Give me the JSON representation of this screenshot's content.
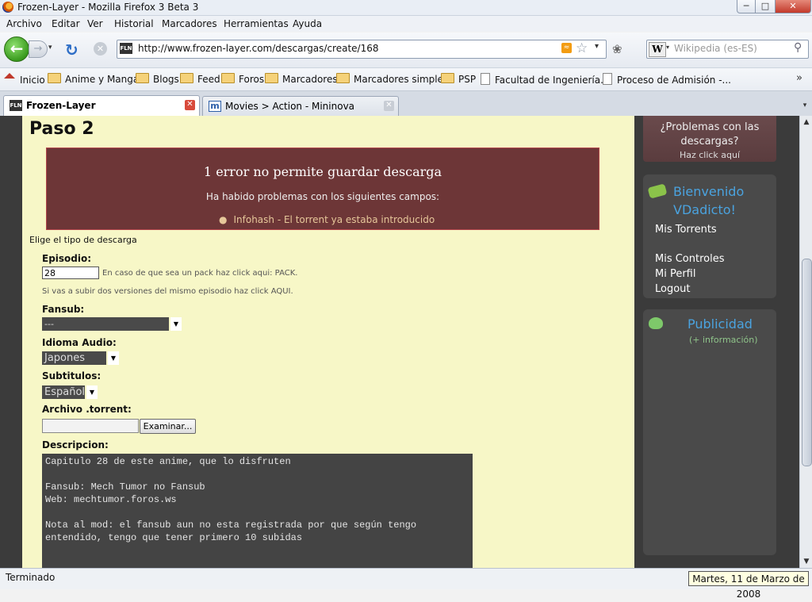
{
  "window": {
    "title": "Frozen-Layer - Mozilla Firefox 3 Beta 3",
    "min": "─",
    "max": "□",
    "close": "✕"
  },
  "menu": [
    "Archivo",
    "Editar",
    "Ver",
    "Historial",
    "Marcadores",
    "Herramientas",
    "Ayuda"
  ],
  "nav": {
    "back": "←",
    "forward": "→",
    "history": "▾",
    "reload": "↻",
    "stop": "✕",
    "url": "http://www.frozen-layer.com/descargas/create/168",
    "url_favicon": "FLN",
    "search_placeholder": "Wikipedia (es-ES)",
    "search_engine": "W"
  },
  "bookmarks": [
    "Inicio",
    "Anime y Manga",
    "Blogs",
    "Feed",
    "Foros",
    "Marcadores",
    "Marcadores simples",
    "PSP",
    "Facultad de Ingeniería...",
    "Proceso de Admisión -..."
  ],
  "bookmarks_more": "»",
  "tabs": [
    {
      "label": "Frozen-Layer",
      "favicon": "FLN",
      "active": true
    },
    {
      "label": "Movies > Action - Mininova",
      "favicon": "m",
      "active": false
    }
  ],
  "page": {
    "heading": "Paso 2",
    "error_title": "1 error no permite guardar descarga",
    "error_subtitle": "Ha habido problemas con los siguientes campos:",
    "error_item": "Infohash - El torrent ya estaba introducido",
    "choose_type": "Elige el tipo de descarga",
    "episodio_label": "Episodio:",
    "episodio_value": "28",
    "episodio_hint": "En caso de que sea un pack haz click aqui: PACK.",
    "episodio_hint2": "Si vas a subir dos versiones del mismo episodio haz click AQUI.",
    "fansub_label": "Fansub:",
    "fansub_value": "---",
    "idioma_label": "Idioma Audio:",
    "idioma_value": "Japones",
    "subtitulos_label": "Subtitulos:",
    "subtitulos_value": "Español",
    "archivo_label": "Archivo .torrent:",
    "archivo_button": "Examinar...",
    "descripcion_label": "Descripcion:",
    "descripcion_value": "Capitulo 28 de este anime, que lo disfruten\n\nFansub: Mech Tumor no Fansub\nWeb: mechtumor.foros.ws\n\nNota al mod: el fansub aun no esta registrada por que según tengo\nentendido, tengo que tener primero 10 subidas"
  },
  "sidebar": {
    "problems_text": "¿Problemas con las descargas?",
    "problems_link": "Haz click aquí",
    "welcome": "Bienvenido VDadicto!",
    "links": [
      "Mis Torrents",
      "Mis Controles",
      "Mi Perfil",
      "Logout"
    ],
    "ad_title": "Publicidad",
    "ad_info": "(+ información)"
  },
  "status": {
    "text": "Terminado",
    "date": "Martes, 11 de Marzo de 2008"
  },
  "colors": {
    "page_bg": "#f7f7c7",
    "error_bg": "#6d3637",
    "sidebar_bg": "#3b3b3b",
    "link_blue": "#4aa3df"
  }
}
